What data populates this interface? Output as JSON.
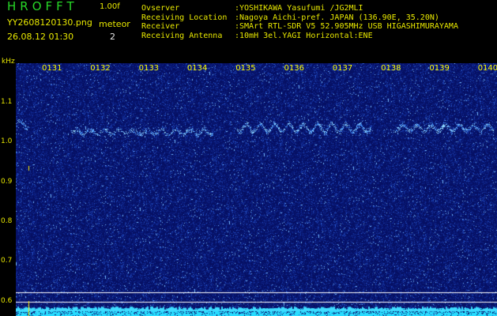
{
  "header": {
    "app_title": "HROFFT",
    "version": "1.00f",
    "filename": "YY2608120130.png",
    "mode": "meteor",
    "count": "2",
    "datetime": "26.08.12 01:30"
  },
  "info": [
    {
      "label": "Ovserver",
      "value": ":YOSHIKAWA Yasufumi /JG2MLI"
    },
    {
      "label": "Receiving Location",
      "value": ":Nagoya Aichi-pref. JAPAN (136.90E, 35.20N)"
    },
    {
      "label": "Receiver",
      "value": ":SMArt RTL-SDR V5 52.905MHz USB HIGASHIMURAYAMA"
    },
    {
      "label": "Receiving Antenna",
      "value": ":10mH 3el.YAGI Horizontal:ENE"
    }
  ],
  "axis": {
    "y_unit": "kHz",
    "y_ticks": [
      "1.1",
      "1.0",
      "0.9",
      "0.8",
      "0.7",
      "0.6"
    ],
    "y_values": [
      1.1,
      1.0,
      0.9,
      0.8,
      0.7,
      0.6
    ],
    "x_ticks": [
      "0131",
      "0132",
      "0133",
      "0134",
      "0135",
      "0136",
      "0137",
      "0138",
      "0139",
      "0140"
    ]
  },
  "colors": {
    "background": "#06106a",
    "signal": "#7fd8ff",
    "grid": "#ffffff",
    "label": "#e8e800"
  }
}
